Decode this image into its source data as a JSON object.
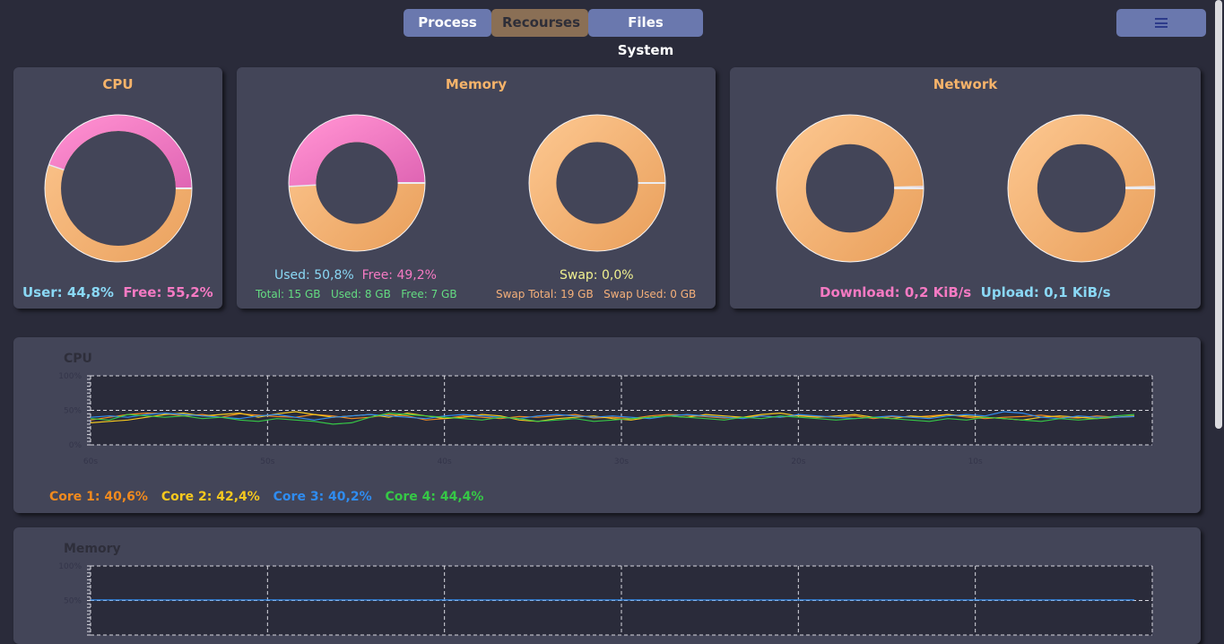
{
  "nav": {
    "tabs": [
      {
        "label": "Process"
      },
      {
        "label": "Recourses"
      },
      {
        "label": "Files System"
      }
    ],
    "active_tab": "Recourses",
    "menu_icon": "hamburger-icon"
  },
  "cpu_card": {
    "title": "CPU",
    "user_label": "User: 44,8%",
    "free_label": "Free: 55,2%",
    "user_fraction": 0.448
  },
  "memory_card": {
    "title": "Memory",
    "used_label": "Used: 50,8%",
    "free_label": "Free: 49,2%",
    "total_label": "Total: 15 GB",
    "used_gb_label": "Used: 8 GB",
    "free_gb_label": "Free: 7 GB",
    "used_fraction": 0.508,
    "swap_label": "Swap: 0,0%",
    "swap_total_label": "Swap Total: 19 GB",
    "swap_used_label": "Swap Used: 0 GB",
    "swap_fraction": 0.0
  },
  "network_card": {
    "title": "Network",
    "download_label": "Download: 0,2 KiB/s",
    "upload_label": "Upload: 0,1 KiB/s",
    "download_fraction": 0.004,
    "upload_fraction": 0.004
  },
  "cpu_history": {
    "title": "CPU",
    "legend": [
      {
        "label": "Core 1: 40,6%",
        "color": "#f08a1e"
      },
      {
        "label": "Core 2: 42,4%",
        "color": "#f5c81e"
      },
      {
        "label": "Core 3: 40,2%",
        "color": "#2f8cf0"
      },
      {
        "label": "Core 4: 44,4%",
        "color": "#36c846"
      }
    ]
  },
  "memory_history": {
    "title": "Memory"
  },
  "colors": {
    "accent_orange": "#f5b36a",
    "donut_used": "#ee6fb9",
    "donut_free": "#eea865",
    "nav_button": "#6a78ae",
    "nav_active": "#8a6f55"
  },
  "chart_data": [
    {
      "type": "line",
      "title": "CPU",
      "xlabel": "",
      "ylabel": "",
      "x_tick_labels": [
        "60s",
        "50s",
        "40s",
        "30s",
        "20s",
        "10s"
      ],
      "y_tick_labels": [
        "100%",
        "50%",
        "0%"
      ],
      "ylim": [
        0,
        100
      ],
      "grid": true,
      "series": [
        {
          "name": "Core 1",
          "values": [
            36,
            40,
            44,
            46,
            45,
            42,
            44,
            40,
            45,
            43,
            41,
            40,
            44,
            42,
            38,
            40,
            44,
            42,
            36,
            38,
            42,
            40,
            38,
            41,
            40,
            42,
            44,
            39,
            40,
            38,
            42,
            44,
            43,
            41,
            39,
            40,
            42,
            40,
            43,
            41,
            40,
            42,
            38,
            41,
            40,
            42,
            44,
            40,
            38,
            40,
            41,
            43,
            40,
            39,
            42,
            40,
            41
          ]
        },
        {
          "name": "Core 2",
          "values": [
            32,
            34,
            36,
            40,
            44,
            46,
            42,
            44,
            46,
            40,
            45,
            48,
            44,
            40,
            42,
            44,
            40,
            46,
            42,
            38,
            40,
            44,
            42,
            36,
            34,
            38,
            40,
            42,
            38,
            36,
            40,
            42,
            40,
            44,
            42,
            40,
            44,
            46,
            42,
            40,
            42,
            44,
            40,
            38,
            42,
            40,
            44,
            42,
            40,
            38,
            36,
            40,
            42,
            40,
            38,
            40,
            42
          ]
        },
        {
          "name": "Core 3",
          "values": [
            40,
            42,
            40,
            44,
            46,
            44,
            42,
            40,
            38,
            42,
            44,
            40,
            36,
            40,
            42,
            44,
            42,
            40,
            38,
            42,
            44,
            42,
            40,
            38,
            42,
            44,
            42,
            40,
            42,
            40,
            38,
            42,
            44,
            42,
            40,
            38,
            42,
            40,
            44,
            42,
            40,
            38,
            40,
            42,
            40,
            38,
            42,
            44,
            42,
            48,
            46,
            40,
            38,
            42,
            40,
            40,
            41
          ]
        },
        {
          "name": "Core 4",
          "values": [
            38,
            36,
            44,
            42,
            40,
            42,
            38,
            40,
            36,
            34,
            38,
            36,
            34,
            30,
            32,
            40,
            46,
            44,
            42,
            40,
            38,
            36,
            40,
            38,
            34,
            36,
            38,
            34,
            36,
            38,
            40,
            42,
            40,
            38,
            36,
            40,
            38,
            42,
            40,
            38,
            36,
            38,
            40,
            38,
            36,
            34,
            38,
            36,
            40,
            38,
            36,
            34,
            38,
            36,
            38,
            42,
            44
          ]
        }
      ]
    },
    {
      "type": "line",
      "title": "Memory",
      "xlabel": "",
      "ylabel": "",
      "y_tick_labels": [
        "100%",
        "50%"
      ],
      "ylim": [
        0,
        100
      ],
      "grid": true,
      "series": [
        {
          "values": [
            50.8,
            50.8,
            50.8,
            50.8,
            50.8,
            50.8,
            50.8,
            50.8,
            50.8,
            50.8,
            50.8,
            50.8,
            50.8,
            50.8,
            50.8,
            50.8,
            50.8,
            50.8,
            50.8,
            50.8,
            50.8,
            50.8,
            50.8,
            50.8,
            50.8,
            50.8,
            50.8,
            50.8,
            50.8,
            50.8,
            50.8,
            50.8,
            50.8,
            50.8,
            50.8,
            50.8,
            50.8,
            50.8,
            50.8,
            50.8,
            50.8,
            50.8,
            50.8,
            50.8,
            50.8,
            50.8,
            50.8,
            50.8,
            50.8,
            50.8,
            50.8,
            50.8,
            50.8,
            50.8,
            50.8,
            50.8,
            50.8
          ]
        }
      ]
    }
  ]
}
